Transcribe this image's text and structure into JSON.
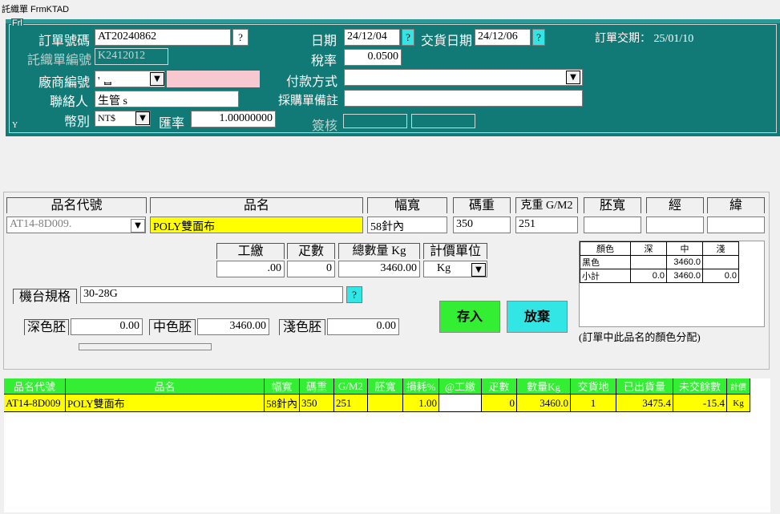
{
  "window_title": "託織單  FrmKTAD",
  "frame_label": "Frl",
  "frame_corner": "Y",
  "header": {
    "order_no_label": "訂單號碼",
    "order_no": "AT20240862",
    "weave_no_label": "託織單編號",
    "weave_no": "K2412012",
    "vendor_label": "廠商編號",
    "vendor_code": "' ᆸ",
    "contact_label": "聯絡人",
    "contact": "生管 s",
    "currency_label": "幣別",
    "currency": "NT$",
    "exrate_label": "匯率",
    "exrate": "1.00000000",
    "date_label": "日期",
    "date": "24/12/04",
    "delivery_label": "交貨日期",
    "delivery": "24/12/06",
    "tax_label": "稅率",
    "tax": "0.0500",
    "payment_label": "付款方式",
    "payment": "",
    "remark_label": "採購單備註",
    "remark": "",
    "approve_label": "簽核",
    "order_due": "訂單交期：  25/01/10",
    "q": "?"
  },
  "detail": {
    "h_code": "品名代號",
    "h_name": "品名",
    "h_width": "幅寬",
    "h_yard": "碼重",
    "h_gsm": "克重 G/M2",
    "h_embryo": "胚寬",
    "h_warp": "經",
    "h_weft": "緯",
    "code": "AT14-8D009.",
    "name": "POLY雙面布",
    "width": "58針內",
    "yard": "350",
    "gsm": "251",
    "h_labor": "工繳",
    "h_count": "疋數",
    "h_total": "總數量 Kg",
    "h_unit": "計價單位",
    "labor": ".00",
    "count": "0",
    "total": "3460.00",
    "unit": "Kg",
    "machine_label": "機台規格",
    "machine": "30-28G",
    "dark_label": "深色胚",
    "dark": "0.00",
    "mid_label": "中色胚",
    "mid": "3460.00",
    "light_label": "淺色胚",
    "light": "0.00",
    "save": "存入",
    "cancel": "放棄",
    "color_note": "(訂單中此品名的顏色分配)"
  },
  "color_table": {
    "headers": [
      "顏色",
      "深",
      "中",
      "淺"
    ],
    "rows": [
      [
        "黑色",
        "",
        "3460.0",
        ""
      ],
      [
        "小計",
        "0.0",
        "3460.0",
        "0.0"
      ]
    ]
  },
  "grid": {
    "headers": [
      "品名代號",
      "品名",
      "幅寬",
      "碼重",
      "G/M2",
      "胚寬",
      "損耗%",
      "@工繳",
      "疋數",
      "數量Kg",
      "交貨地",
      "已出貨量",
      "未交餘數",
      "計價"
    ],
    "rows": [
      [
        "AT14-8D009",
        "POLY雙面布",
        "58針內",
        "350",
        "251",
        "",
        "1.00",
        "",
        "0",
        "3460.0",
        "1",
        "3475.4",
        "-15.4",
        "Kg"
      ]
    ]
  },
  "colors": {
    "teal": "#127a76",
    "yellow": "#ffff00",
    "green": "#33ee33",
    "cyan": "#33e6e6"
  }
}
